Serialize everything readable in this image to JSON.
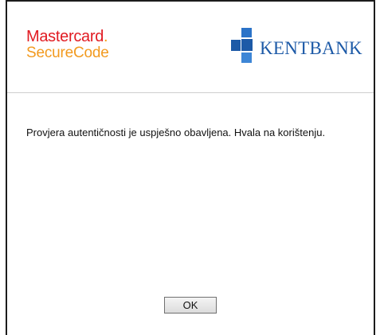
{
  "header": {
    "mastercard_logo": {
      "line1": "Mastercard",
      "line1_dot": ".",
      "line2": "SecureCode",
      "colors": {
        "red": "#e11b22",
        "orange": "#f29a1f"
      }
    },
    "bank_logo": {
      "text": "KENTBANK",
      "icon": "kentbank-cross-icon",
      "colors": {
        "primary": "#1d5aa7",
        "light": "#3d86d6"
      }
    }
  },
  "main": {
    "message": "Provjera autentičnosti je uspješno obavljena. Hvala na korištenju."
  },
  "footer": {
    "ok_label": "OK"
  }
}
